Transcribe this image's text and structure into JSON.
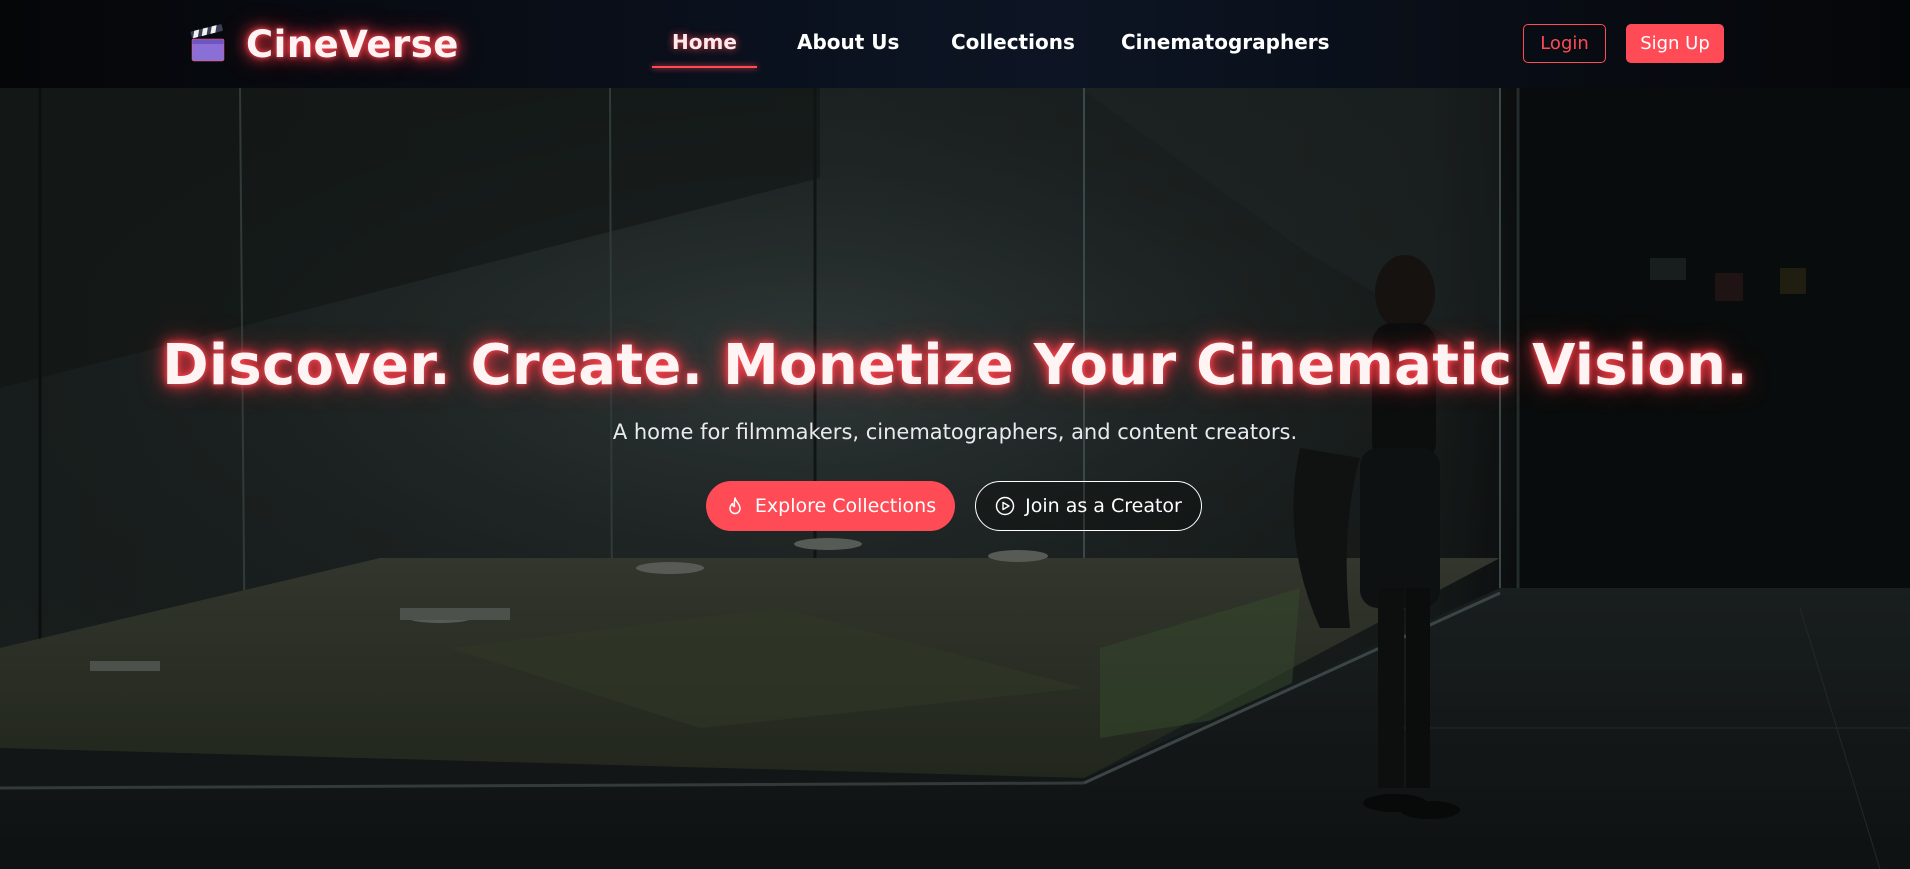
{
  "brand": {
    "name": "CineVerse",
    "icon": "clapperboard-icon"
  },
  "nav": {
    "items": [
      {
        "label": "Home",
        "active": true
      },
      {
        "label": "About Us",
        "active": false
      },
      {
        "label": "Collections",
        "active": false
      },
      {
        "label": "Cinematographers",
        "active": false
      }
    ]
  },
  "auth": {
    "login_label": "Login",
    "signup_label": "Sign Up"
  },
  "hero": {
    "title": "Discover. Create. Monetize Your Cinematic Vision.",
    "subtitle": "A home for filmmakers, cinematographers, and content creators.",
    "primary_cta": {
      "label": "Explore Collections",
      "icon": "flame-icon"
    },
    "secondary_cta": {
      "label": "Join as a Creator",
      "icon": "play-circle-icon"
    }
  },
  "colors": {
    "accent": "#ff4b55",
    "nav_background": "#0b1220",
    "text": "#ffffff"
  }
}
